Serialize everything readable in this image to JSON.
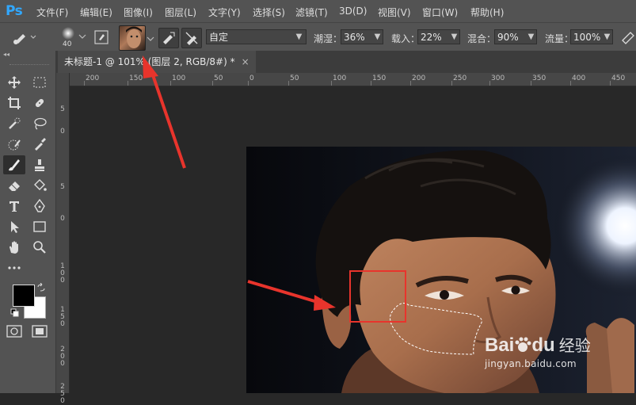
{
  "app": {
    "logo": "Ps"
  },
  "menu": [
    {
      "label": "文件(F)"
    },
    {
      "label": "编辑(E)"
    },
    {
      "label": "图像(I)"
    },
    {
      "label": "图层(L)"
    },
    {
      "label": "文字(Y)"
    },
    {
      "label": "选择(S)"
    },
    {
      "label": "滤镜(T)"
    },
    {
      "label": "3D(D)"
    },
    {
      "label": "视图(V)"
    },
    {
      "label": "窗口(W)"
    },
    {
      "label": "帮助(H)"
    }
  ],
  "options": {
    "brush_size": "40",
    "mode_value": "自定",
    "exposure_label": "潮湿：",
    "exposure_value": "36%",
    "load_label": "载入：",
    "load_value": "22%",
    "mix_label": "混合：",
    "mix_value": "90%",
    "flow_label": "流量：",
    "flow_value": "100%"
  },
  "document": {
    "tab_title": "未标题-1 @ 101% (图层 2, RGB/8#) *",
    "close_glyph": "×"
  },
  "ruler": {
    "h_labels": [
      "200",
      "150",
      "100",
      "50",
      "0",
      "50",
      "100",
      "150",
      "200",
      "250",
      "300",
      "350",
      "400",
      "450"
    ],
    "v_labels": [
      "5",
      "0",
      "5",
      "0",
      "1\n0\n0",
      "1\n5\n0",
      "2\n0\n0",
      "2\n5\n0"
    ]
  },
  "watermark": {
    "brand": "Bai",
    "brand2": "du",
    "cn": "经验",
    "url": "jingyan.baidu.com"
  },
  "colors": {
    "accent": "#31a8ff",
    "annotation": "#e8342c",
    "chrome": "#535353",
    "canvas": "#282828"
  }
}
